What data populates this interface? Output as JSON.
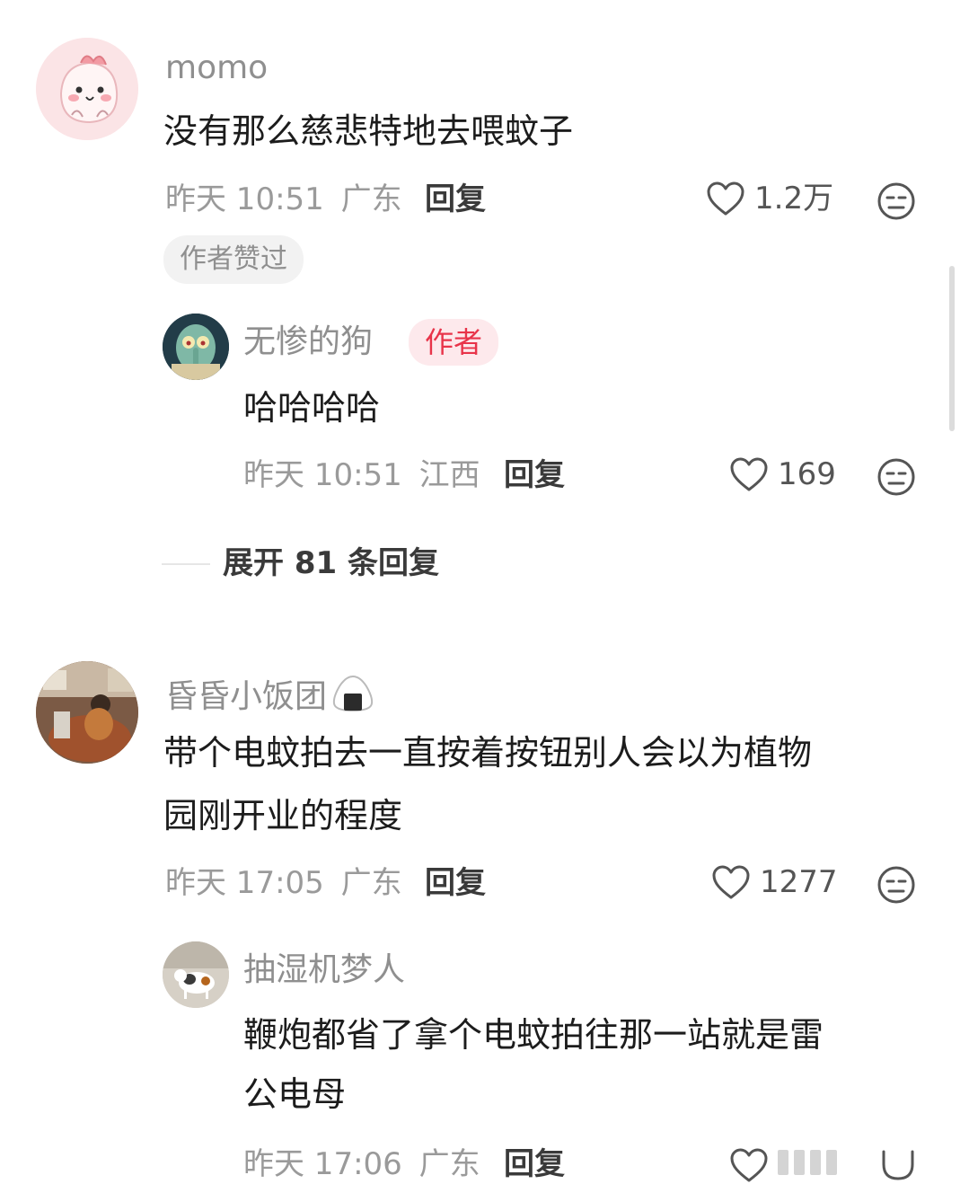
{
  "comments": [
    {
      "username": "momo",
      "text": "没有那么慈悲特地去喂蚊子",
      "time": "昨天 10:51",
      "location": "广东",
      "reply_label": "回复",
      "likes": "1.2万",
      "author_liked_label": "作者赞过",
      "replies": [
        {
          "username": "无惨的狗",
          "author_badge": "作者",
          "text": "哈哈哈哈",
          "time": "昨天 10:51",
          "location": "江西",
          "reply_label": "回复",
          "likes": "169"
        }
      ],
      "expand_label": "展开 81 条回复"
    },
    {
      "username": "昏昏小饭团",
      "text_line1": "带个电蚊拍去一直按着按钮别人会以为植物",
      "text_line2": "园刚开业的程度",
      "time": "昨天 17:05",
      "location": "广东",
      "reply_label": "回复",
      "likes": "1277",
      "replies": [
        {
          "username": "抽湿机梦人",
          "text_line1": "鞭炮都省了拿个电蚊拍往那一站就是雷",
          "text_line2": "公电母",
          "time": "昨天 17:06",
          "location": "广东",
          "reply_label": "回复"
        }
      ]
    }
  ],
  "icons": {
    "like": "heart-outline-icon",
    "dislike": "meh-face-icon",
    "rice_ball": "onigiri-icon"
  },
  "colors": {
    "author_badge_text": "#e8344a",
    "author_badge_bg": "#fde9ec",
    "username": "#8f8f8f",
    "meta": "#9a9a9a"
  }
}
